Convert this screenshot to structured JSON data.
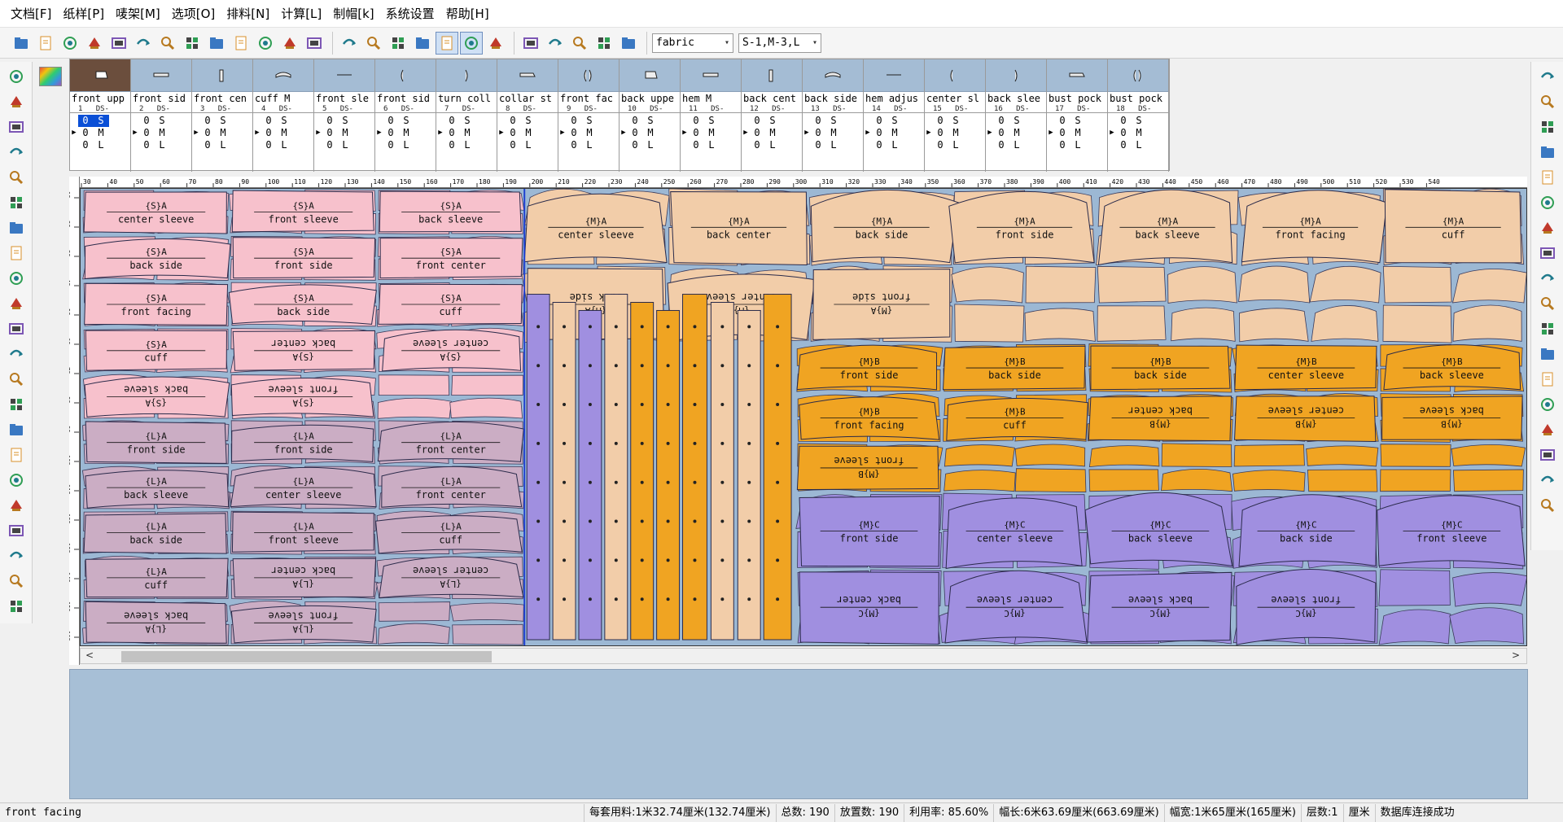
{
  "menus": [
    "文档[F]",
    "纸样[P]",
    "唛架[M]",
    "选项[O]",
    "排料[N]",
    "计算[L]",
    "制帽[k]",
    "系统设置",
    "帮助[H]"
  ],
  "toolbar": {
    "icons": [
      "open-folder-icon",
      "new-document-icon",
      "open-pattern-icon",
      "import-icon",
      "save-marker-icon",
      "print-icon",
      "plotter-icon",
      "preview-icon",
      "undo-icon",
      "redo-icon",
      "piece-info-icon",
      "measure-icon",
      "tools-icon",
      "color-wheel-icon",
      "grid-icon",
      "text-icon",
      "export-icon",
      "marker-view-icon",
      "list-view-icon",
      "layout-icon",
      "rotate-icon",
      "flip-icon",
      "book-icon",
      "delete-icon",
      "layers-icon"
    ],
    "fabric_select": "fabric",
    "size_select": "S-1,M-3,L"
  },
  "left_tools": [
    "select-arrow-icon",
    "zoom-window-icon",
    "zoom-in-icon",
    "zoom-fit-icon",
    "move-icon",
    "rotate-piece-icon",
    "magnify-icon",
    "mirror-icon",
    "ruler-icon",
    "headphone-icon",
    "cut-icon",
    "chain-icon",
    "copy-icon",
    "text-icon",
    "m-icon",
    "spin-icon",
    "pattern-icon",
    "overlap-icon",
    "connect-icon",
    "cross-icon",
    "search-icon",
    "settings-icon"
  ],
  "right_tools": [
    "zoom-page-icon",
    "zoom-in-icon",
    "zoom-out-icon",
    "cloud-icon",
    "tree-icon",
    "view3d-icon",
    "cloud2-icon",
    "lock-icon",
    "rect-icon",
    "stack-icon",
    "eraser-icon",
    "split-icon",
    "arrange-icon",
    "down-icon",
    "cross-icon",
    "layer-icon",
    "grid2-icon",
    "exit-icon"
  ],
  "pieces": [
    {
      "name": "front upp",
      "num": "1",
      "meta": "DS-"
    },
    {
      "name": "front sid",
      "num": "2",
      "meta": "DS-"
    },
    {
      "name": "front cen",
      "num": "3",
      "meta": "DS-"
    },
    {
      "name": "cuff     M",
      "num": "4",
      "meta": "DS-"
    },
    {
      "name": "front sle",
      "num": "5",
      "meta": "DS-"
    },
    {
      "name": "front sid",
      "num": "6",
      "meta": "DS-"
    },
    {
      "name": "turn coll",
      "num": "7",
      "meta": "DS-"
    },
    {
      "name": "collar st",
      "num": "8",
      "meta": "DS-"
    },
    {
      "name": "front fac",
      "num": "9",
      "meta": "DS-"
    },
    {
      "name": "back uppe",
      "num": "10",
      "meta": "DS-"
    },
    {
      "name": "hem      M",
      "num": "11",
      "meta": "DS-"
    },
    {
      "name": "back cent",
      "num": "12",
      "meta": "DS-"
    },
    {
      "name": "back side",
      "num": "13",
      "meta": "DS-"
    },
    {
      "name": "hem adjus",
      "num": "14",
      "meta": "DS-"
    },
    {
      "name": "center sl",
      "num": "15",
      "meta": "DS-"
    },
    {
      "name": "back slee",
      "num": "16",
      "meta": "DS-"
    },
    {
      "name": "bust pock",
      "num": "17",
      "meta": "DS-"
    },
    {
      "name": "bust pock",
      "num": "18",
      "meta": "DS-"
    }
  ],
  "size_rows": [
    {
      "q": "0",
      "sz": "S"
    },
    {
      "q": "0",
      "sz": "M"
    },
    {
      "q": "0",
      "sz": "L"
    }
  ],
  "ruler_top": [
    "30",
    "40",
    "50",
    "60",
    "70",
    "80",
    "90",
    "100",
    "110",
    "120",
    "130",
    "140",
    "150",
    "160",
    "170",
    "180",
    "190",
    "200",
    "210",
    "220",
    "230",
    "240",
    "250",
    "260",
    "270",
    "280",
    "290",
    "300",
    "310",
    "320",
    "330",
    "340",
    "350",
    "360",
    "370",
    "380",
    "390",
    "400",
    "410",
    "420",
    "430",
    "440",
    "450",
    "460",
    "470",
    "480",
    "490",
    "500",
    "510",
    "520",
    "530",
    "540"
  ],
  "ruler_left": [
    "10",
    "20",
    "30",
    "40",
    "50",
    "60",
    "70",
    "80",
    "90",
    "100",
    "110",
    "120",
    "130",
    "140",
    "150",
    "160"
  ],
  "marker": {
    "colors": {
      "S": "#f7c1cc",
      "L": "#cbadc4",
      "M1": "#f2cda9",
      "M2": "#f0a422",
      "MC": "#a08fe0"
    },
    "labels": [
      {
        "group": "S",
        "text": "{S}A",
        "sub": "center sleeve",
        "flip": false
      },
      {
        "group": "S",
        "text": "{S}A",
        "sub": "front sleeve",
        "flip": false
      },
      {
        "group": "S",
        "text": "{S}A",
        "sub": "back sleeve",
        "flip": false
      },
      {
        "group": "S",
        "text": "{S}A",
        "sub": "back side",
        "flip": false
      },
      {
        "group": "S",
        "text": "{S}A",
        "sub": "front side",
        "flip": false
      },
      {
        "group": "S",
        "text": "{S}A",
        "sub": "front center",
        "flip": false
      },
      {
        "group": "S",
        "text": "{S}A",
        "sub": "front facing",
        "flip": false
      },
      {
        "group": "S",
        "text": "{S}A",
        "sub": "back side",
        "flip": false
      },
      {
        "group": "S",
        "text": "{S}A",
        "sub": "cuff",
        "flip": false
      },
      {
        "group": "S",
        "text": "{S}A",
        "sub": "cuff",
        "flip": false
      },
      {
        "group": "S",
        "text": "{S}A",
        "sub": "back center",
        "flip": true
      },
      {
        "group": "S",
        "text": "{S}A",
        "sub": "center sleeve",
        "flip": true
      },
      {
        "group": "S",
        "text": "{S}A",
        "sub": "back sleeve",
        "flip": true
      },
      {
        "group": "S",
        "text": "{S}A",
        "sub": "front sleeve",
        "flip": true
      },
      {
        "group": "L",
        "text": "{L}A",
        "sub": "front side",
        "flip": false
      },
      {
        "group": "L",
        "text": "{L}A",
        "sub": "front side",
        "flip": false
      },
      {
        "group": "L",
        "text": "{L}A",
        "sub": "front center",
        "flip": false
      },
      {
        "group": "L",
        "text": "{L}A",
        "sub": "back sleeve",
        "flip": false
      },
      {
        "group": "L",
        "text": "{L}A",
        "sub": "center sleeve",
        "flip": false
      },
      {
        "group": "L",
        "text": "{L}A",
        "sub": "front center",
        "flip": false
      },
      {
        "group": "L",
        "text": "{L}A",
        "sub": "back side",
        "flip": false
      },
      {
        "group": "L",
        "text": "{L}A",
        "sub": "front sleeve",
        "flip": false
      },
      {
        "group": "L",
        "text": "{L}A",
        "sub": "cuff",
        "flip": false
      },
      {
        "group": "L",
        "text": "{L}A",
        "sub": "cuff",
        "flip": false
      },
      {
        "group": "L",
        "text": "{L}A",
        "sub": "back center",
        "flip": true
      },
      {
        "group": "L",
        "text": "{L}A",
        "sub": "center sleeve",
        "flip": true
      },
      {
        "group": "L",
        "text": "{L}A",
        "sub": "back sleeve",
        "flip": true
      },
      {
        "group": "L",
        "text": "{L}A",
        "sub": "front sleeve",
        "flip": true
      },
      {
        "group": "M1",
        "text": "{M}A",
        "sub": "center sleeve",
        "flip": false
      },
      {
        "group": "M1",
        "text": "{M}A",
        "sub": "back center",
        "flip": false
      },
      {
        "group": "M1",
        "text": "{M}A",
        "sub": "back side",
        "flip": false
      },
      {
        "group": "M1",
        "text": "{M}A",
        "sub": "front side",
        "flip": false
      },
      {
        "group": "M1",
        "text": "{M}A",
        "sub": "back sleeve",
        "flip": false
      },
      {
        "group": "M1",
        "text": "{M}A",
        "sub": "front facing",
        "flip": false
      },
      {
        "group": "M1",
        "text": "{M}A",
        "sub": "cuff",
        "flip": false
      },
      {
        "group": "M1",
        "text": "{M}A",
        "sub": "back side",
        "flip": true
      },
      {
        "group": "M1",
        "text": "{M}A",
        "sub": "center sleeve",
        "flip": true
      },
      {
        "group": "M1",
        "text": "{M}A",
        "sub": "front side",
        "flip": true
      },
      {
        "group": "M2",
        "text": "{M}B",
        "sub": "front side",
        "flip": false
      },
      {
        "group": "M2",
        "text": "{M}B",
        "sub": "back side",
        "flip": false
      },
      {
        "group": "M2",
        "text": "{M}B",
        "sub": "back side",
        "flip": false
      },
      {
        "group": "M2",
        "text": "{M}B",
        "sub": "center sleeve",
        "flip": false
      },
      {
        "group": "M2",
        "text": "{M}B",
        "sub": "back sleeve",
        "flip": false
      },
      {
        "group": "M2",
        "text": "{M}B",
        "sub": "front facing",
        "flip": false
      },
      {
        "group": "M2",
        "text": "{M}B",
        "sub": "cuff",
        "flip": false
      },
      {
        "group": "M2",
        "text": "{M}B",
        "sub": "back center",
        "flip": true
      },
      {
        "group": "M2",
        "text": "{M}B",
        "sub": "center sleeve",
        "flip": true
      },
      {
        "group": "M2",
        "text": "{M}B",
        "sub": "back sleeve",
        "flip": true
      },
      {
        "group": "M2",
        "text": "{M}B",
        "sub": "front sleeve",
        "flip": true
      },
      {
        "group": "MC",
        "text": "{M}C",
        "sub": "front side",
        "flip": false
      },
      {
        "group": "MC",
        "text": "{M}C",
        "sub": "center sleeve",
        "flip": false
      },
      {
        "group": "MC",
        "text": "{M}C",
        "sub": "back sleeve",
        "flip": false
      },
      {
        "group": "MC",
        "text": "{M}C",
        "sub": "back side",
        "flip": false
      },
      {
        "group": "MC",
        "text": "{M}C",
        "sub": "front sleeve",
        "flip": false
      },
      {
        "group": "MC",
        "text": "{M}C",
        "sub": "back center",
        "flip": true
      },
      {
        "group": "MC",
        "text": "{M}C",
        "sub": "center sleeve",
        "flip": true
      },
      {
        "group": "MC",
        "text": "{M}C",
        "sub": "back sleeve",
        "flip": true
      },
      {
        "group": "MC",
        "text": "{M}C",
        "sub": "front sleeve",
        "flip": true
      }
    ]
  },
  "status": {
    "selected_piece": "front facing",
    "usage_per_set": "每套用料:1米32.74厘米(132.74厘米)",
    "total": "总数: 190",
    "placed": "放置数: 190",
    "utilization": "利用率: 85.60%",
    "length": "幅长:6米63.69厘米(663.69厘米)",
    "width": "幅宽:1米65厘米(165厘米)",
    "layers": "层数:1",
    "unit": "厘米",
    "db_status": "数据库连接成功"
  }
}
